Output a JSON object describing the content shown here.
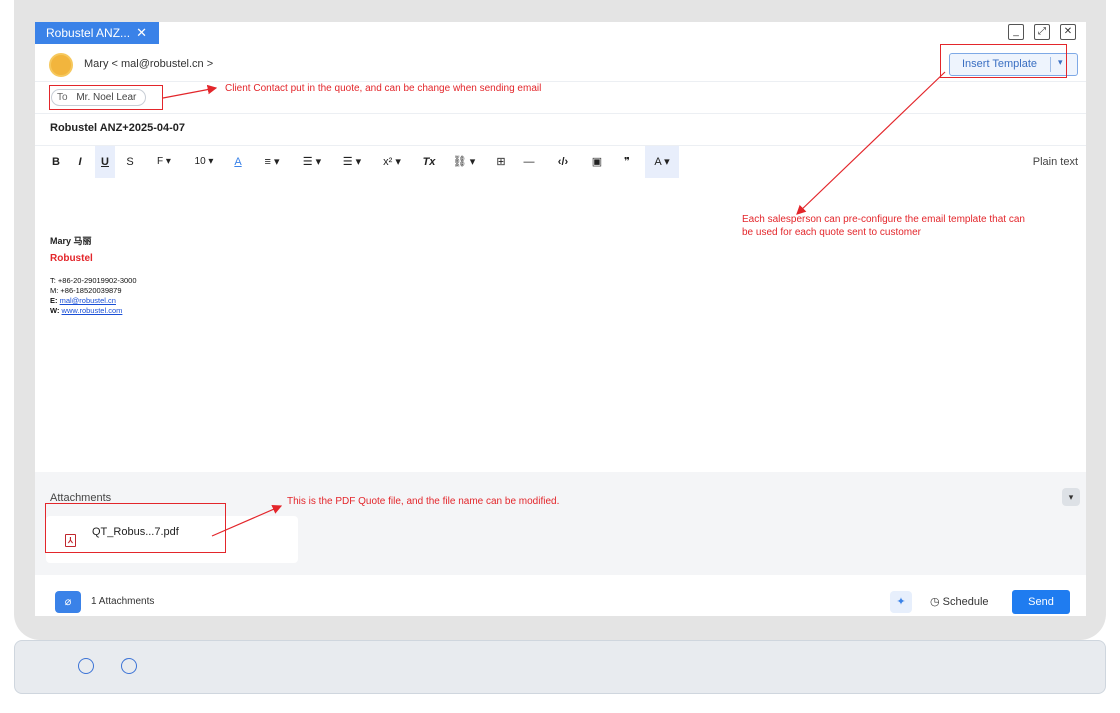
{
  "tab": {
    "title": "Robustel ANZ...",
    "close": "✕"
  },
  "window_controls": {
    "minimize": "_",
    "maximize": "⤢",
    "close": "✕"
  },
  "from": {
    "text": "Mary < mal@robustel.cn >"
  },
  "insert_template": {
    "label": "Insert Template",
    "dropdown": "▾"
  },
  "to": {
    "label": "To",
    "recipient": "Mr. Noel Lear"
  },
  "subject": "Robustel ANZ+2025-04-07",
  "toolbar": {
    "bold": "B",
    "italic": "I",
    "underline": "U",
    "strike": "S",
    "font": "F ▾",
    "size": "10 ▾",
    "color": "A",
    "align": "≡ ▾",
    "list": "☰ ▾",
    "indent": "☰ ▾",
    "superscript": "x² ▾",
    "clear": "Tx",
    "link": "⛓ ▾",
    "table": "⊞",
    "hr": "—",
    "code": "‹/›",
    "image": "▣",
    "quote": "❞",
    "spell": "A ▾",
    "plain_text": "Plain text"
  },
  "signature": {
    "name": "Mary 马丽",
    "company": "Robustel",
    "phone_t": "T: +86-20-29019902-3000",
    "phone_m": "M: +86-18520039879",
    "email_label": "E: ",
    "email": "mal@robustel.cn",
    "web_label": "W: ",
    "web": "www.robustel.com"
  },
  "attachments": {
    "title": "Attachments",
    "file_name": "QT_Robus...7.pdf",
    "file_icon": "pdf-icon"
  },
  "footer": {
    "attach_count": "1 Attachments",
    "schedule": "Schedule",
    "send": "Send"
  },
  "annotations": {
    "contact": "Client Contact put in the quote, and can be change when sending email",
    "template_line1": "Each salesperson can pre-configure the email template that can",
    "template_line2": "be used for each quote sent to customer",
    "pdf": "This is the PDF Quote file, and the file name can be modified."
  },
  "colors": {
    "accent": "#1f7cf0",
    "annotation": "#e3262b",
    "tab": "#3a82e8"
  }
}
